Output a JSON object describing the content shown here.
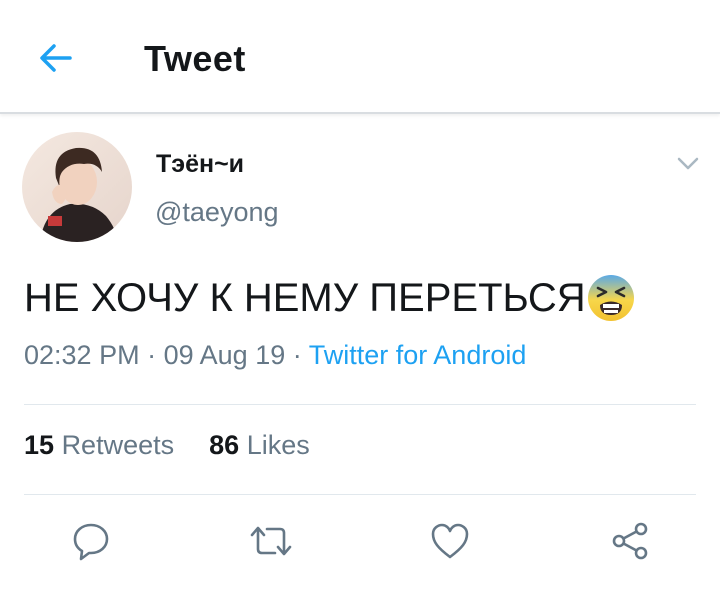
{
  "header": {
    "title": "Tweet"
  },
  "tweet": {
    "display_name": "Тэён~и",
    "handle": "@taeyong",
    "text": "НЕ ХОЧУ К НЕМУ ПЕРЕТЬСЯ",
    "time": "02:32 PM",
    "date": "09 Aug 19",
    "separator": "·",
    "source": "Twitter for Android"
  },
  "stats": {
    "retweets_count": "15",
    "retweets_label": "Retweets",
    "likes_count": "86",
    "likes_label": "Likes"
  },
  "icons": {
    "back": "arrow-left-icon",
    "menu": "chevron-down-icon",
    "reply": "reply-icon",
    "retweet": "retweet-icon",
    "like": "heart-icon",
    "share": "share-icon",
    "emoji": "anxious-face-emoji"
  },
  "colors": {
    "accent": "#1da1f2",
    "secondary_text": "#657786",
    "divider": "#e1e8ed"
  }
}
